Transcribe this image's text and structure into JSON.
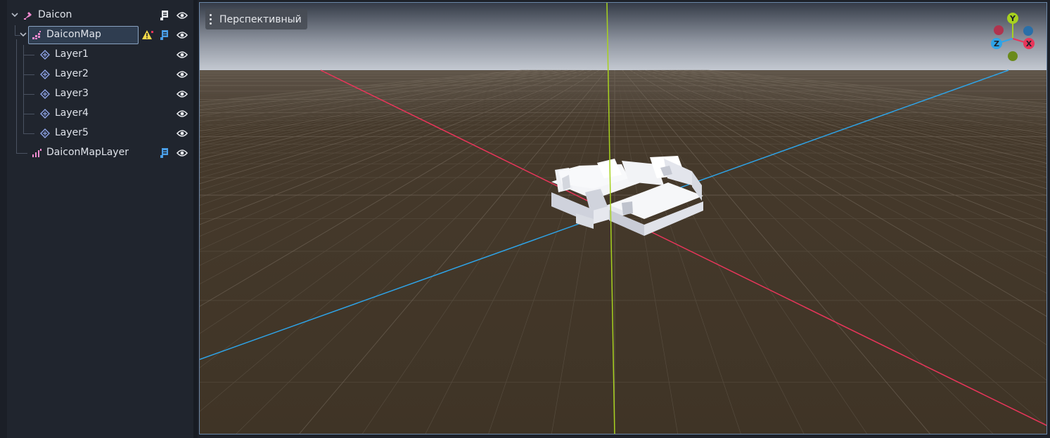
{
  "scene_tree": {
    "root": {
      "label": "Daicon"
    },
    "map": {
      "label": "DaiconMap"
    },
    "layers": [
      {
        "label": "Layer1"
      },
      {
        "label": "Layer2"
      },
      {
        "label": "Layer3"
      },
      {
        "label": "Layer4"
      },
      {
        "label": "Layer5"
      }
    ],
    "map_layer": {
      "label": "DaiconMapLayer"
    }
  },
  "viewport": {
    "view_menu_label": "Перспективный",
    "gizmo": {
      "y_label": "Y",
      "x_label": "X",
      "z_label": "Z"
    }
  },
  "colors": {
    "x_axis": "#e8355a",
    "y_axis": "#a7d11f",
    "z_axis": "#2ea4e8",
    "ground": "#3f3426",
    "sky_top": "#c9ced6",
    "node_pink": "#f08ad0",
    "node_blue": "#8ea4e8",
    "script_blue": "#4a9ee6",
    "warning": "#f5d949"
  },
  "icons": [
    "chevron-down-icon",
    "node-icon",
    "map-icon",
    "layer-icon",
    "script-icon",
    "warning-icon",
    "eye-icon"
  ]
}
